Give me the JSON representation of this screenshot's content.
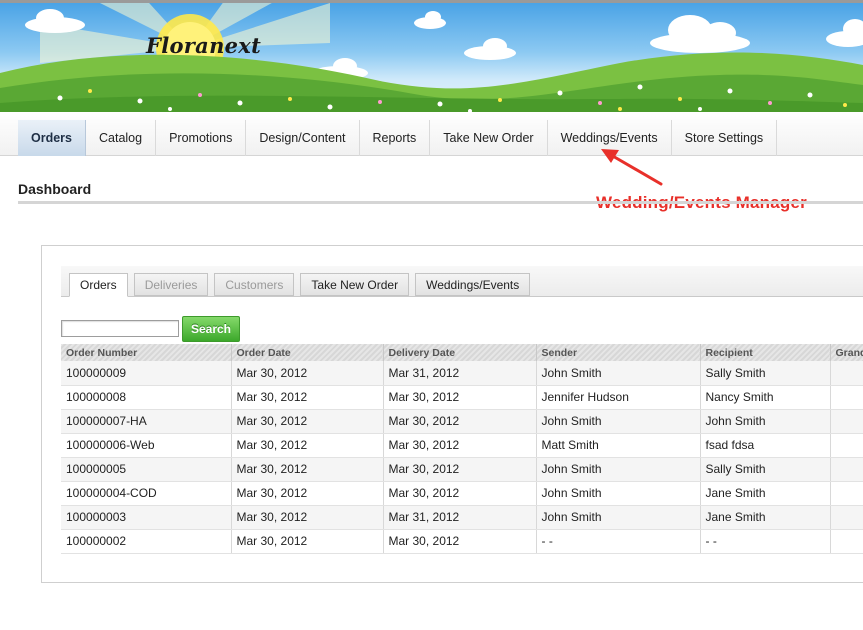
{
  "brand": {
    "logo_text": "Floranext"
  },
  "topnav": {
    "items": [
      {
        "label": "Orders",
        "active": true
      },
      {
        "label": "Catalog"
      },
      {
        "label": "Promotions"
      },
      {
        "label": "Design/Content"
      },
      {
        "label": "Reports"
      },
      {
        "label": "Take New Order"
      },
      {
        "label": "Weddings/Events"
      },
      {
        "label": "Store Settings"
      }
    ]
  },
  "annotation": {
    "text": "Wedding/Events Manager",
    "color": "#e8302a"
  },
  "page": {
    "title": "Dashboard"
  },
  "tabs": [
    {
      "label": "Orders",
      "state": "active"
    },
    {
      "label": "Deliveries",
      "state": "disabled"
    },
    {
      "label": "Customers",
      "state": "disabled"
    },
    {
      "label": "Take New Order",
      "state": "normal"
    },
    {
      "label": "Weddings/Events",
      "state": "normal"
    }
  ],
  "search": {
    "value": "",
    "button_label": "Search"
  },
  "table": {
    "columns": [
      "Order Number",
      "Order Date",
      "Delivery Date",
      "Sender",
      "Recipient",
      "Grand Total"
    ],
    "rows": [
      [
        "100000009",
        "Mar 30, 2012",
        "Mar 31, 2012",
        "John Smith",
        "Sally Smith",
        ""
      ],
      [
        "100000008",
        "Mar 30, 2012",
        "Mar 30, 2012",
        "Jennifer Hudson",
        "Nancy Smith",
        ""
      ],
      [
        "100000007-HA",
        "Mar 30, 2012",
        "Mar 30, 2012",
        "John Smith",
        "John Smith",
        ""
      ],
      [
        "100000006-Web",
        "Mar 30, 2012",
        "Mar 30, 2012",
        "Matt Smith",
        "fsad fdsa",
        ""
      ],
      [
        "100000005",
        "Mar 30, 2012",
        "Mar 30, 2012",
        "John Smith",
        "Sally Smith",
        ""
      ],
      [
        "100000004-COD",
        "Mar 30, 2012",
        "Mar 30, 2012",
        "John Smith",
        "Jane Smith",
        ""
      ],
      [
        "100000003",
        "Mar 30, 2012",
        "Mar 31, 2012",
        "John Smith",
        "Jane Smith",
        ""
      ],
      [
        "100000002",
        "Mar 30, 2012",
        "Mar 30, 2012",
        "- -",
        "- -",
        ""
      ]
    ]
  },
  "colors": {
    "accent_green": "#3ca82b",
    "active_nav": "#c8d9ea",
    "annotation_red": "#e8302a"
  }
}
